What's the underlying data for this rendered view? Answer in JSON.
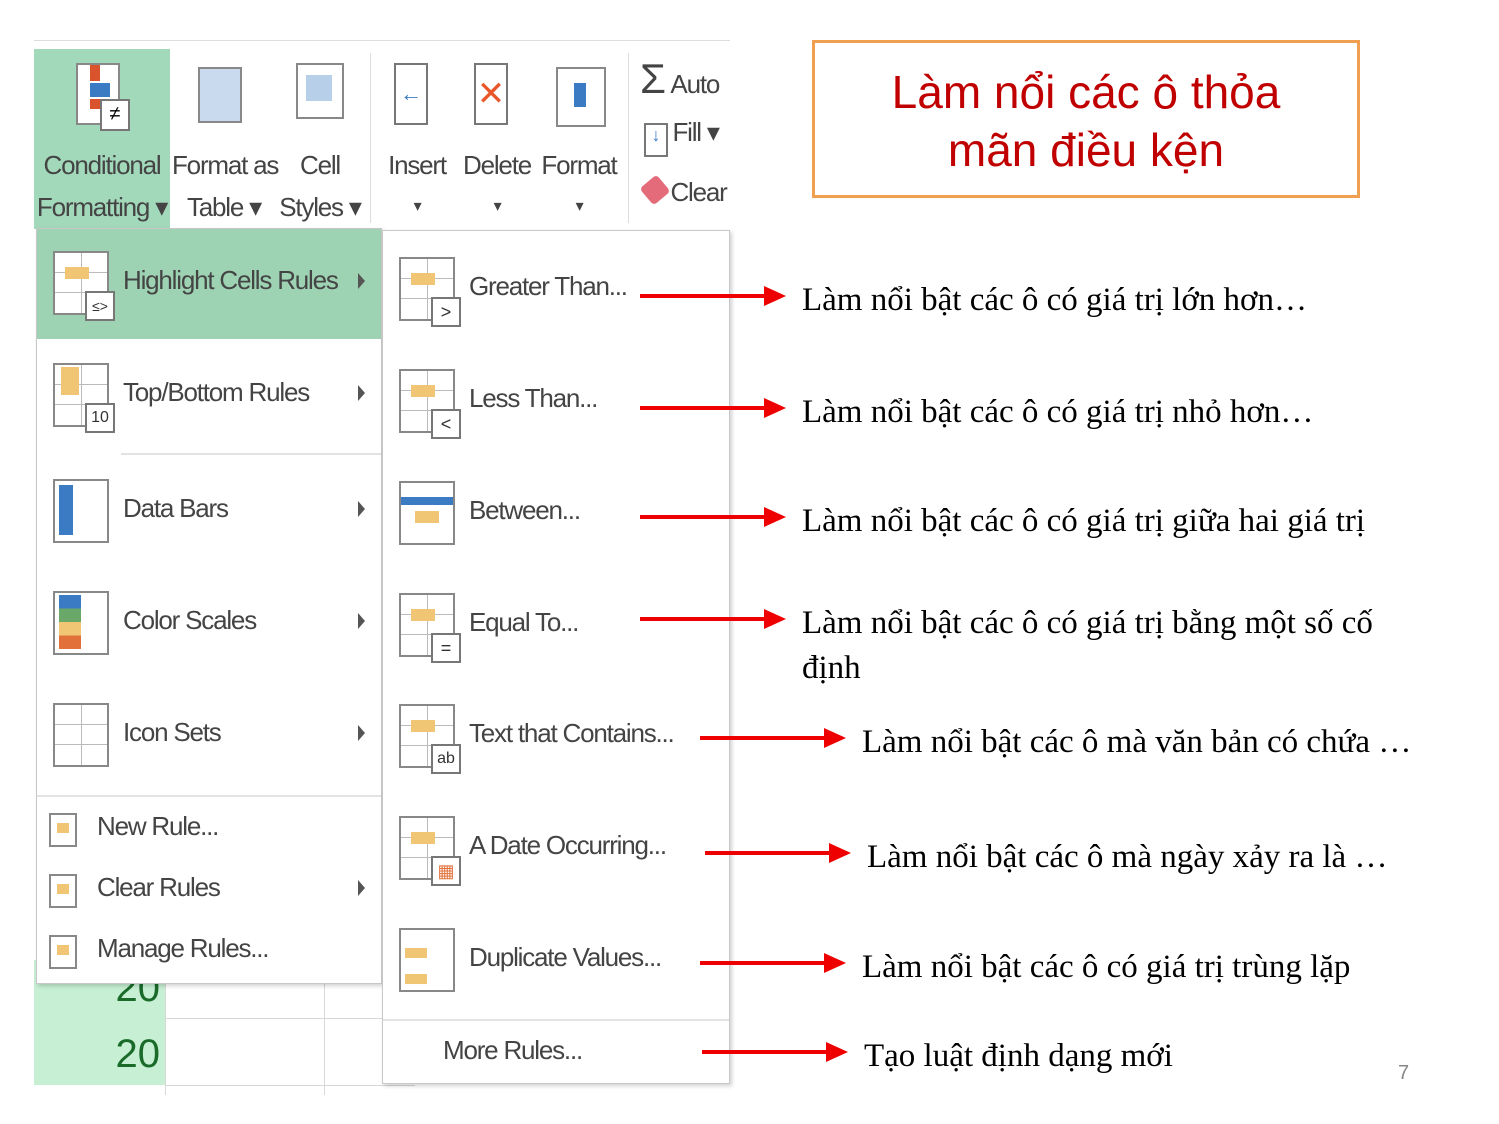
{
  "title": {
    "line1": "Làm nổi các ô thỏa",
    "line2": "mãn điều kện"
  },
  "ribbon": {
    "conditional_formatting": {
      "line1": "Conditional",
      "line2": "Formatting ▾"
    },
    "format_as_table": {
      "line1": "Format as",
      "line2": "Table ▾"
    },
    "cell_styles": {
      "line1": "Cell",
      "line2": "Styles ▾"
    },
    "insert": "Insert",
    "delete": "Delete",
    "format": "Format",
    "autosum": "Auto",
    "fill": "Fill ▾",
    "clear": "Clear",
    "accent": "#a3d9bb"
  },
  "menu": {
    "items": [
      {
        "label": "Highlight Cells Rules",
        "icon": "highlight-cells-icon",
        "submenu": true,
        "selected": true
      },
      {
        "label": "Top/Bottom Rules",
        "icon": "top-bottom-icon",
        "submenu": true
      },
      {
        "label": "Data Bars",
        "icon": "data-bars-icon",
        "submenu": true
      },
      {
        "label": "Color Scales",
        "icon": "color-scales-icon",
        "submenu": true
      },
      {
        "label": "Icon Sets",
        "icon": "icon-sets-icon",
        "submenu": true
      }
    ],
    "small_items": [
      {
        "label": "New Rule...",
        "icon": "new-rule-icon"
      },
      {
        "label": "Clear Rules",
        "icon": "clear-rules-icon",
        "submenu": true
      },
      {
        "label": "Manage Rules...",
        "icon": "manage-rules-icon"
      }
    ]
  },
  "submenu": {
    "items": [
      {
        "label": "Greater Than...",
        "badge": ">"
      },
      {
        "label": "Less Than...",
        "badge": "<"
      },
      {
        "label": "Between...",
        "badge": ""
      },
      {
        "label": "Equal To...",
        "badge": "="
      },
      {
        "label": "Text that Contains...",
        "badge": "ab"
      },
      {
        "label": "A Date Occurring...",
        "badge": "▦"
      },
      {
        "label": "Duplicate Values...",
        "badge": ""
      }
    ],
    "more_rules": "More Rules..."
  },
  "annotations": [
    "Làm nổi bật các ô có giá trị lớn hơn…",
    "Làm nổi bật các ô có giá trị nhỏ hơn…",
    "Làm nổi bật các ô có giá trị giữa hai giá trị",
    "Làm nổi bật các ô có giá trị bằng một số cố",
    "định",
    "Làm nổi bật các ô mà văn bản có chứa …",
    "Làm nổi bật các ô mà ngày xảy ra là …",
    "Làm nổi bật các ô có giá trị trùng lặp",
    "Tạo luật định dạng mới"
  ],
  "cells": [
    "20",
    "20"
  ],
  "page_number": "7"
}
